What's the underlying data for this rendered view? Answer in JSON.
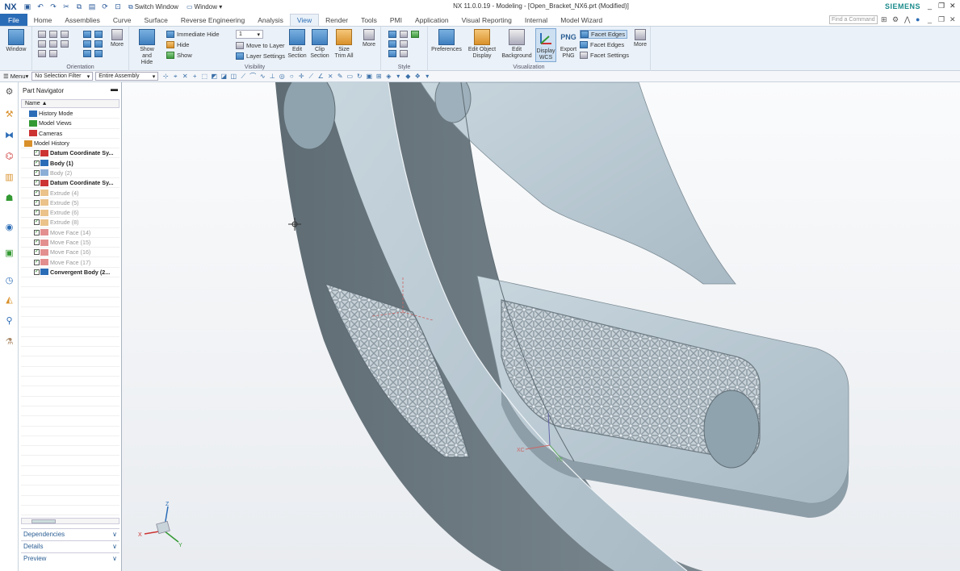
{
  "titlebar": {
    "logo": "NX",
    "switch_window": "Switch Window",
    "window_menu": "Window",
    "title": "NX 11.0.0.19 - Modeling - [Open_Bracket_NX6.prt (Modified)]",
    "brand": "SIEMENS"
  },
  "tabs": [
    {
      "label": "File"
    },
    {
      "label": "Home"
    },
    {
      "label": "Assemblies"
    },
    {
      "label": "Curve"
    },
    {
      "label": "Surface"
    },
    {
      "label": "Reverse Engineering"
    },
    {
      "label": "Analysis"
    },
    {
      "label": "View"
    },
    {
      "label": "Render"
    },
    {
      "label": "Tools"
    },
    {
      "label": "PMI"
    },
    {
      "label": "Application"
    },
    {
      "label": "Visual Reporting"
    },
    {
      "label": "Internal"
    },
    {
      "label": "Model Wizard"
    }
  ],
  "find_command_placeholder": "Find a Command",
  "ribbon": {
    "window_label": "Window",
    "orientation_label": "Orientation",
    "more_label": "More",
    "show_hide_label": "Show and Hide",
    "immediate_hide": "Immediate Hide",
    "hide": "Hide",
    "show": "Show",
    "layer_value": "1",
    "move_to_layer": "Move to Layer",
    "layer_settings": "Layer Settings",
    "visibility_label": "Visibility",
    "edit_section": "Edit Section",
    "clip_section": "Clip Section",
    "size_trim_all": "Size Trim All",
    "style_label": "Style",
    "preferences": "Preferences",
    "edit_object_display": "Edit Object Display",
    "edit_background": "Edit Background",
    "display_wcs": "Display WCS",
    "export_png": "Export PNG",
    "png": "PNG",
    "facet_edges_1": "Facet Edges",
    "facet_edges_2": "Facet Edges",
    "facet_settings": "Facet Settings",
    "visualization_label": "Visualization"
  },
  "selbar": {
    "menu_label": "Menu",
    "filter": "No Selection Filter",
    "scope": "Entire Assembly"
  },
  "navigator": {
    "title": "Part Navigator",
    "column": "Name",
    "items": [
      {
        "label": "History Mode",
        "style": "normal",
        "icon": "history-icon"
      },
      {
        "label": "Model Views",
        "style": "normal",
        "icon": "model-views-icon"
      },
      {
        "label": "Cameras",
        "style": "normal",
        "icon": "cameras-icon"
      },
      {
        "label": "Model History",
        "style": "normal",
        "icon": "folder-icon"
      },
      {
        "label": "Datum Coordinate Sy...",
        "style": "bold",
        "icon": "datum-csys-icon"
      },
      {
        "label": "Body (1)",
        "style": "bold",
        "icon": "body-icon"
      },
      {
        "label": "Body (2)",
        "style": "dim",
        "icon": "body-icon"
      },
      {
        "label": "Datum Coordinate Sy...",
        "style": "bold",
        "icon": "datum-csys-icon"
      },
      {
        "label": "Extrude (4)",
        "style": "dim",
        "icon": "extrude-icon"
      },
      {
        "label": "Extrude (5)",
        "style": "dim",
        "icon": "extrude-icon"
      },
      {
        "label": "Extrude (6)",
        "style": "dim",
        "icon": "extrude-icon"
      },
      {
        "label": "Extrude (8)",
        "style": "dim",
        "icon": "extrude-icon"
      },
      {
        "label": "Move Face (14)",
        "style": "dim",
        "icon": "move-face-icon"
      },
      {
        "label": "Move Face (15)",
        "style": "dim",
        "icon": "move-face-icon"
      },
      {
        "label": "Move Face (16)",
        "style": "dim",
        "icon": "move-face-icon"
      },
      {
        "label": "Move Face (17)",
        "style": "dim",
        "icon": "move-face-icon"
      },
      {
        "label": "Convergent Body (2...",
        "style": "bold",
        "icon": "convergent-body-icon"
      }
    ],
    "panels": [
      {
        "label": "Dependencies"
      },
      {
        "label": "Details"
      },
      {
        "label": "Preview"
      }
    ]
  },
  "viewport": {
    "wcs_x": "XC",
    "wcs_y": "YC",
    "triad_x": "X",
    "triad_y": "Y",
    "triad_z": "Z"
  },
  "colors": {
    "accent": "#2b6cb6",
    "ribbon_bg": "#eaf1f8",
    "model_face": "#b9c9d3",
    "model_side": "#6f7c84"
  }
}
